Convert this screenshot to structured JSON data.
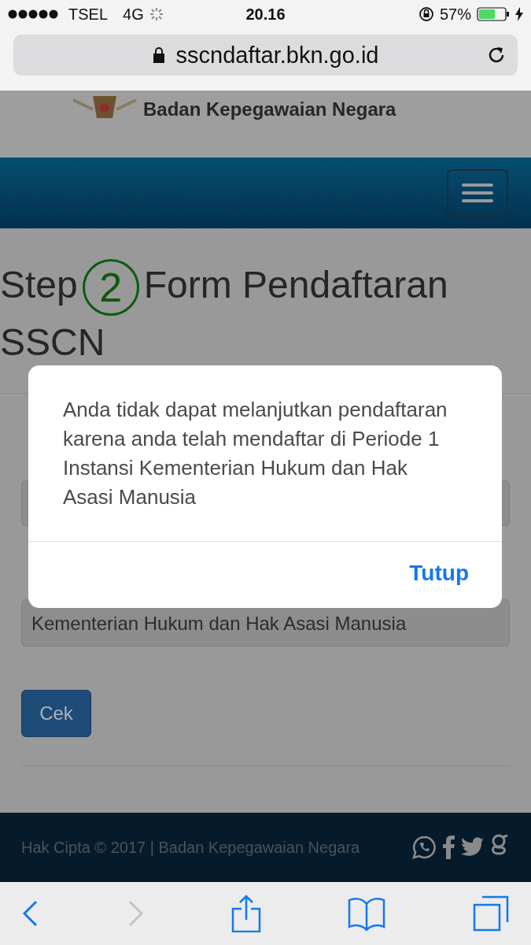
{
  "status_bar": {
    "carrier": "TSEL",
    "network": "4G",
    "time": "20.16",
    "battery": "57%"
  },
  "browser": {
    "url": "sscndaftar.bkn.go.id"
  },
  "site": {
    "org_name": "Badan Kepegawaian Negara"
  },
  "title": {
    "step_label": "Step",
    "step_number": "2",
    "lines": [
      "Form Pendaftaran",
      "SSCN"
    ]
  },
  "form": {
    "select": {
      "value": "Kementerian Hukum dan Hak Asasi Manusia"
    },
    "button": "Cek"
  },
  "footer": {
    "copyright": "Hak Cipta © 2017 | Badan Kepegawaian Negara"
  },
  "dialog": {
    "message": "Anda tidak dapat melanjutkan pendaftaran karena anda telah mendaftar di Periode 1 Instansi Kementerian Hukum dan Hak Asasi Manusia",
    "button": "Tutup"
  },
  "toolbar": [
    {
      "kind": "back",
      "disabled": false
    },
    {
      "kind": "forward",
      "disabled": true
    },
    {
      "kind": "share",
      "disabled": false
    },
    {
      "kind": "bookmarks",
      "disabled": false
    },
    {
      "kind": "tabs",
      "disabled": false
    }
  ]
}
